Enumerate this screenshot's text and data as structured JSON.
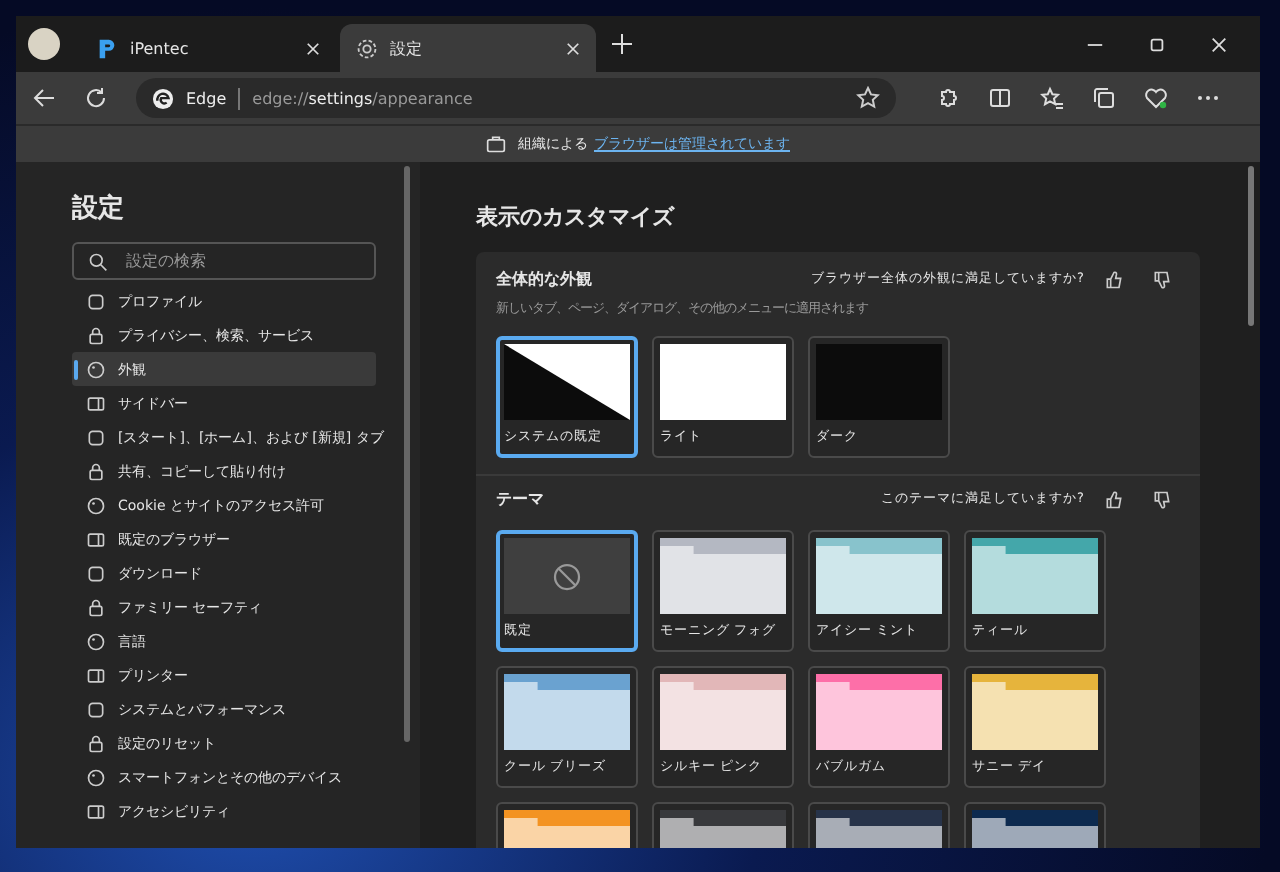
{
  "tabs": [
    {
      "title": "iPentec",
      "selected": false
    },
    {
      "title": "設定",
      "selected": true
    }
  ],
  "address_bar": {
    "brand": "Edge",
    "url": "edge://**settings**/appearance"
  },
  "info_bar": {
    "text": "組織による",
    "link": "ブラウザーは管理されています"
  },
  "sidebar": {
    "title": "設定",
    "search": {
      "placeholder": "設定の検索"
    },
    "items": [
      {
        "label": "プロファイル",
        "selected": false
      },
      {
        "label": "プライバシー、検索、サービス",
        "selected": false
      },
      {
        "label": "外観",
        "selected": true
      },
      {
        "label": "サイドバー",
        "selected": false
      },
      {
        "label": "[スタート]、[ホーム]、および [新規] タブ",
        "selected": false
      },
      {
        "label": "共有、コピーして貼り付け",
        "selected": false
      },
      {
        "label": "Cookie とサイトのアクセス許可",
        "selected": false
      },
      {
        "label": "既定のブラウザー",
        "selected": false
      },
      {
        "label": "ダウンロード",
        "selected": false
      },
      {
        "label": "ファミリー セーフティ",
        "selected": false
      },
      {
        "label": "言語",
        "selected": false
      },
      {
        "label": "プリンター",
        "selected": false
      },
      {
        "label": "システムとパフォーマンス",
        "selected": false
      },
      {
        "label": "設定のリセット",
        "selected": false
      },
      {
        "label": "スマートフォンとその他のデバイス",
        "selected": false
      },
      {
        "label": "アクセシビリティ",
        "selected": false
      }
    ]
  },
  "main": {
    "heading": "表示のカスタマイズ",
    "appearance": {
      "title": "全体的な外観",
      "question": "ブラウザー全体の外観に満足していますか?",
      "subtitle": "新しいタブ、ページ、ダイアログ、その他のメニューに適用されます",
      "options": [
        {
          "label": "システムの既定",
          "kind": "system",
          "selected": true
        },
        {
          "label": "ライト",
          "kind": "light",
          "selected": false
        },
        {
          "label": "ダーク",
          "kind": "dark",
          "selected": false
        }
      ]
    },
    "theme": {
      "title": "テーマ",
      "question": "このテーマに満足していますか?",
      "themes": [
        {
          "label": "既定",
          "kind": "default",
          "selected": true
        },
        {
          "label": "モーニング フォグ",
          "kind": "folder",
          "color": "#b4b8c2",
          "selected": false
        },
        {
          "label": "アイシー ミント",
          "kind": "folder",
          "color": "#88c3cc",
          "selected": false
        },
        {
          "label": "ティール",
          "kind": "folder",
          "color": "#44a7aa",
          "selected": false
        },
        {
          "label": "クール ブリーズ",
          "kind": "folder",
          "color": "#6aa2d0",
          "selected": false
        },
        {
          "label": "シルキー ピンク",
          "kind": "folder",
          "color": "#e2b7b8",
          "selected": false
        },
        {
          "label": "バブルガム",
          "kind": "folder",
          "color": "#fd6fa8",
          "selected": false
        },
        {
          "label": "サニー デイ",
          "kind": "folder",
          "color": "#e6b43c",
          "selected": false
        },
        {
          "kind": "folder",
          "color": "#f39322",
          "selected": false
        },
        {
          "kind": "folder",
          "color": "#38393c",
          "selected": false
        },
        {
          "kind": "folder",
          "color": "#273349",
          "selected": false
        },
        {
          "kind": "folder",
          "color": "#0d2a4f",
          "selected": false
        }
      ]
    }
  }
}
